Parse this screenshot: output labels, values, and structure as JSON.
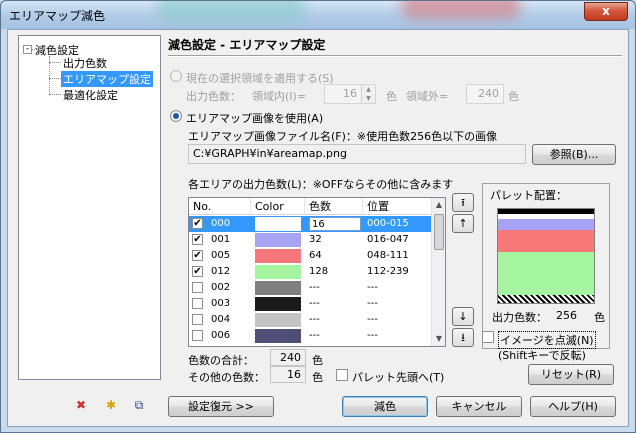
{
  "window": {
    "title": "エリアマップ減色",
    "close_glyph": "x"
  },
  "tree": {
    "expander": "-",
    "root": "減色設定",
    "children": [
      "出力色数",
      "エリアマップ設定",
      "最適化設定"
    ],
    "selected": "エリアマップ設定"
  },
  "bottom_tools": [
    {
      "icon": "delete-icon",
      "glyph": "✖"
    },
    {
      "icon": "new-item-icon",
      "glyph": "✱"
    },
    {
      "icon": "copy-icon",
      "glyph": "⧉"
    }
  ],
  "section": {
    "title": "減色設定 - エリアマップ設定"
  },
  "option_selection": {
    "label": "現在の選択領域を適用する(S)",
    "enabled": false,
    "colors_label": "出力色数：",
    "inside_label": "領域内(I)=",
    "inside_value": "16",
    "unit1": "色",
    "outside_label": "領域外=",
    "outside_value": "240",
    "unit2": "色"
  },
  "option_areamap": {
    "label": "エリアマップ画像を使用(A)",
    "selected": true,
    "file_label": "エリアマップ画像ファイル名(F)：※使用色数256色以下の画像",
    "file_value": "C:¥GRAPH¥in¥areamap.png",
    "browse_label": "参照(B)..."
  },
  "list": {
    "caption": "各エリアの出力色数(L)：※OFFならその他に含みます",
    "columns": [
      "No.",
      "Color",
      "色数",
      "位置"
    ],
    "rows": [
      {
        "checked": true,
        "no": "000",
        "color": "#ffffff",
        "count": "16",
        "pos": "000-015",
        "selected": true
      },
      {
        "checked": true,
        "no": "001",
        "color": "#a8a4f5",
        "count": "32",
        "pos": "016-047",
        "selected": false
      },
      {
        "checked": true,
        "no": "005",
        "color": "#f77878",
        "count": "64",
        "pos": "048-111",
        "selected": false
      },
      {
        "checked": true,
        "no": "012",
        "color": "#a6f5a0",
        "count": "128",
        "pos": "112-239",
        "selected": false
      },
      {
        "checked": false,
        "no": "002",
        "color": "#7f7f7f",
        "count": "---",
        "pos": "---",
        "selected": false
      },
      {
        "checked": false,
        "no": "003",
        "color": "#1a1a1a",
        "count": "---",
        "pos": "---",
        "selected": false
      },
      {
        "checked": false,
        "no": "004",
        "color": "#c4c4c4",
        "count": "---",
        "pos": "---",
        "selected": false
      },
      {
        "checked": false,
        "no": "006",
        "color": "#4f4f7a",
        "count": "---",
        "pos": "---",
        "selected": false
      }
    ],
    "move_buttons": [
      "⭱",
      "↑",
      "↓",
      "⭳"
    ]
  },
  "totals": {
    "sum_label": "色数の合計：",
    "sum_value": "240",
    "sum_unit": "色",
    "other_label": "その他の色数：",
    "other_value": "16",
    "other_unit": "色",
    "palette_head_label": "パレット先頭へ(T)",
    "palette_head_checked": false
  },
  "palette": {
    "title": "パレット配置：",
    "bands": [
      {
        "color": "#000000",
        "portion": 0.06
      },
      {
        "color": "#ffffff",
        "portion": 0.0625
      },
      {
        "color": "#a8a4f5",
        "portion": 0.125
      },
      {
        "color": "#f77878",
        "portion": 0.25
      },
      {
        "color": "#a6f5a0",
        "portion": 0.5
      }
    ],
    "output_label": "出力色数：",
    "output_value": "256",
    "output_unit": "色",
    "blink_label": "イメージを点滅(N)",
    "blink_hint": "(Shiftキーで反転)",
    "reset_label": "リセット(R)"
  },
  "footer": {
    "restore_label": "設定復元 >>",
    "reduce_label": "減色",
    "cancel_label": "キャンセル",
    "help_label": "ヘルプ(H)"
  }
}
